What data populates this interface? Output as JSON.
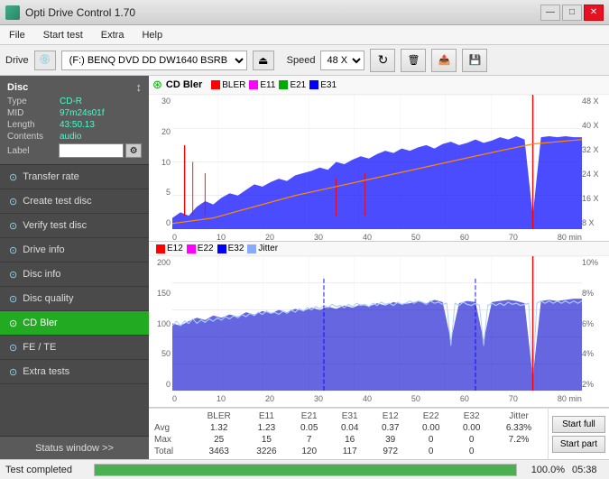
{
  "titlebar": {
    "icon_label": "app-icon",
    "title": "Opti Drive Control 1.70",
    "minimize_label": "—",
    "maximize_label": "□",
    "close_label": "✕"
  },
  "menubar": {
    "items": [
      {
        "id": "menu-file",
        "label": "File"
      },
      {
        "id": "menu-start-test",
        "label": "Start test"
      },
      {
        "id": "menu-extra",
        "label": "Extra"
      },
      {
        "id": "menu-help",
        "label": "Help"
      }
    ]
  },
  "drivebar": {
    "drive_label": "Drive",
    "drive_value": "(F:)  BENQ DVD DD DW1640 BSRB",
    "speed_label": "Speed",
    "speed_value": "48 X"
  },
  "sidebar": {
    "disc_title": "Disc",
    "disc_type_key": "Type",
    "disc_type_val": "CD-R",
    "disc_mid_key": "MID",
    "disc_mid_val": "97m24s01f",
    "disc_length_key": "Length",
    "disc_length_val": "43:50.13",
    "disc_contents_key": "Contents",
    "disc_contents_val": "audio",
    "disc_label_key": "Label",
    "disc_label_val": "",
    "items": [
      {
        "id": "transfer-rate",
        "label": "Transfer rate",
        "active": false
      },
      {
        "id": "create-test-disc",
        "label": "Create test disc",
        "active": false
      },
      {
        "id": "verify-test-disc",
        "label": "Verify test disc",
        "active": false
      },
      {
        "id": "drive-info",
        "label": "Drive info",
        "active": false
      },
      {
        "id": "disc-info",
        "label": "Disc info",
        "active": false
      },
      {
        "id": "disc-quality",
        "label": "Disc quality",
        "active": false
      },
      {
        "id": "cd-bler",
        "label": "CD Bler",
        "active": true
      },
      {
        "id": "fe-te",
        "label": "FE / TE",
        "active": false
      },
      {
        "id": "extra-tests",
        "label": "Extra tests",
        "active": false
      }
    ],
    "status_window_label": "Status window >>"
  },
  "chart1": {
    "title": "CD Bler",
    "legend": [
      {
        "label": "BLER",
        "color": "#ff0000"
      },
      {
        "label": "E11",
        "color": "#ff00ff"
      },
      {
        "label": "E21",
        "color": "#00aa00"
      },
      {
        "label": "E31",
        "color": "#0000ff"
      }
    ],
    "y_axis_left": [
      "30",
      "20",
      "10",
      "5"
    ],
    "y_axis_right": [
      "48 X",
      "40 X",
      "32 X",
      "24 X",
      "16 X",
      "8 X"
    ],
    "x_axis": [
      "0",
      "10",
      "20",
      "30",
      "40",
      "50",
      "60",
      "70",
      "80 min"
    ]
  },
  "chart2": {
    "legend": [
      {
        "label": "E12",
        "color": "#ff0000"
      },
      {
        "label": "E22",
        "color": "#ff00ff"
      },
      {
        "label": "E32",
        "color": "#0000ff"
      },
      {
        "label": "Jitter",
        "color": "#88aaff"
      }
    ],
    "y_axis_left": [
      "200",
      "150",
      "100",
      "50"
    ],
    "y_axis_right": [
      "10%",
      "8%",
      "6%",
      "4%",
      "2%"
    ],
    "x_axis": [
      "0",
      "10",
      "20",
      "30",
      "40",
      "50",
      "60",
      "70",
      "80 min"
    ]
  },
  "stats": {
    "headers": [
      "",
      "BLER",
      "E11",
      "E21",
      "E31",
      "E12",
      "E22",
      "E32",
      "Jitter"
    ],
    "rows": [
      {
        "label": "Avg",
        "bler": "1.32",
        "e11": "1.23",
        "e21": "0.05",
        "e31": "0.04",
        "e12": "0.37",
        "e22": "0.00",
        "e32": "0.00",
        "jitter": "6.33%"
      },
      {
        "label": "Max",
        "bler": "25",
        "e11": "15",
        "e21": "7",
        "e31": "16",
        "e12": "39",
        "e22": "0",
        "e32": "0",
        "jitter": "7.2%"
      },
      {
        "label": "Total",
        "bler": "3463",
        "e11": "3226",
        "e21": "120",
        "e31": "117",
        "e12": "972",
        "e22": "0",
        "e32": "0",
        "jitter": ""
      }
    ],
    "start_full_label": "Start full",
    "start_part_label": "Start part"
  },
  "statusbar": {
    "status_text": "Test completed",
    "progress_pct": "100.0%",
    "progress_value": 100,
    "time": "05:38"
  }
}
